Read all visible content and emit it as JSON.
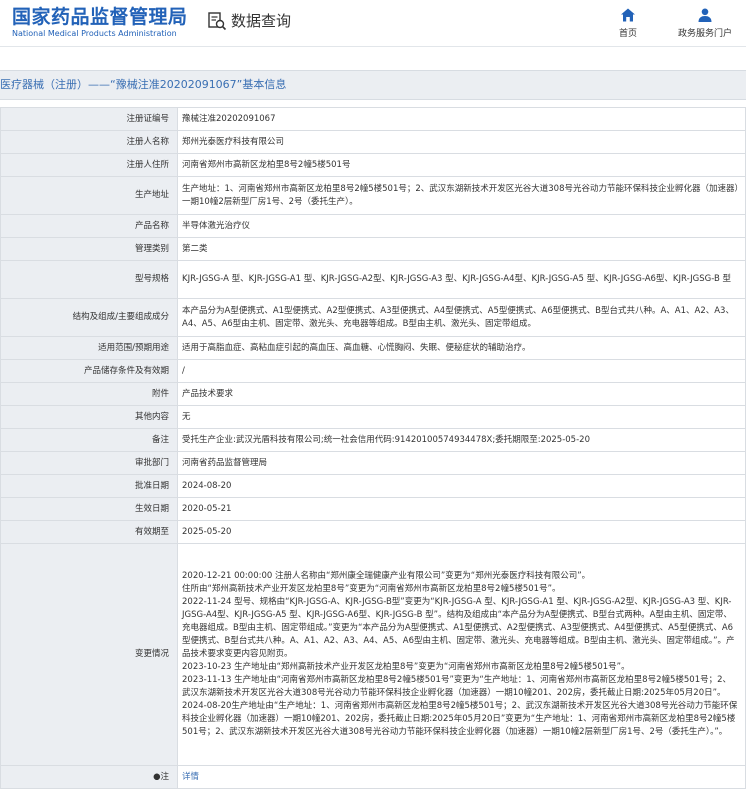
{
  "header": {
    "brand_cn": "国家药品监督管理局",
    "brand_en": "National Medical Products Administration",
    "query_label": "数据查询",
    "nav": [
      {
        "label": "首页",
        "icon": "home-icon"
      },
      {
        "label": "政务服务门户",
        "icon": "user-icon"
      }
    ]
  },
  "title": {
    "prefix": "医疗器械（注册）——",
    "highlight": "“豫械注准20202091067”",
    "suffix": "基本信息"
  },
  "rows": [
    {
      "label": "注册证编号",
      "value": "豫械注准20202091067"
    },
    {
      "label": "注册人名称",
      "value": "郑州光泰医疗科技有限公司"
    },
    {
      "label": "注册人住所",
      "value": "河南省郑州市高新区龙柏里8号2幢5楼501号"
    },
    {
      "label": "生产地址",
      "value": "生产地址：1、河南省郑州市高新区龙柏里8号2幢5楼501号；2、武汉东湖新技术开发区光谷大道308号光谷动力节能环保科技企业孵化器（加速器）一期10幢2层新型厂房1号、2号（委托生产）。"
    },
    {
      "label": "产品名称",
      "value": "半导体激光治疗仪"
    },
    {
      "label": "管理类别",
      "value": "第二类"
    },
    {
      "label": "型号规格",
      "value": "KJR-JGSG-A 型、KJR-JGSG-A1 型、KJR-JGSG-A2型、KJR-JGSG-A3 型、KJR-JGSG-A4型、KJR-JGSG-A5 型、KJR-JGSG-A6型、KJR-JGSG-B 型"
    },
    {
      "label": "结构及组成/主要组成成分",
      "value": "本产品分为A型便携式、A1型便携式、A2型便携式、A3型便携式、A4型便携式、A5型便携式、A6型便携式、B型台式共八种。A、A1、A2、A3、A4、A5、A6型由主机、固定带、激光头、充电器等组成。B型由主机、激光头、固定带组成。"
    },
    {
      "label": "适用范围/预期用途",
      "value": "适用于高脂血症、高粘血症引起的高血压、高血糖、心慌胸闷、失眠、便秘症状的辅助治疗。"
    },
    {
      "label": "产品储存条件及有效期",
      "value": "/"
    },
    {
      "label": "附件",
      "value": "产品技术要求"
    },
    {
      "label": "其他内容",
      "value": "无"
    },
    {
      "label": "备注",
      "value": "受托生产企业:武汉光盾科技有限公司;统一社会信用代码:91420100574934478X;委托期限至:2025-05-20"
    },
    {
      "label": "审批部门",
      "value": "河南省药品监督管理局"
    },
    {
      "label": "批准日期",
      "value": "2024-08-20"
    },
    {
      "label": "生效日期",
      "value": "2020-05-21"
    },
    {
      "label": "有效期至",
      "value": "2025-05-20"
    }
  ],
  "change": {
    "label": "变更情况",
    "lines": [
      "2020-12-21 00:00:00 注册人名称由“郑州康全瑞健康产业有限公司”变更为“郑州光泰医疗科技有限公司”。",
      "住所由“郑州高新技术产业开发区龙柏里8号”变更为“河南省郑州市高新区龙柏里8号2幢5楼501号”。",
      "2022-11-24 型号、规格由“KJR-JGSG-A、KJR-JGSG-B型”变更为“KJR-JGSG-A 型、KJR-JGSG-A1 型、KJR-JGSG-A2型、KJR-JGSG-A3 型、KJR-JGSG-A4型、KJR-JGSG-A5 型、KJR-JGSG-A6型、KJR-JGSG-B 型”。结构及组成由“本产品分为A型便携式、B型台式两种。A型由主机、固定带、充电器组成。B型由主机、固定带组成。”变更为“本产品分为A型便携式、A1型便携式、A2型便携式、A3型便携式、A4型便携式、A5型便携式、A6型便携式、B型台式共八种。A、A1、A2、A3、A4、A5、A6型由主机、固定带、激光头、充电器等组成。B型由主机、激光头、固定带组成。”。产品技术要求变更内容见附页。",
      "2023-10-23 生产地址由“郑州高新技术产业开发区龙柏里8号”变更为“河南省郑州市高新区龙柏里8号2幢5楼501号”。",
      "2023-11-13 生产地址由“河南省郑州市高新区龙柏里8号2幢5楼501号”变更为“生产地址：1、河南省郑州市高新区龙柏里8号2幢5楼501号；2、武汉东湖新技术开发区光谷大道308号光谷动力节能环保科技企业孵化器（加速器）一期10幢201、202房，委托截止日期:2025年05月20日”。2024-08-20生产地址由“生产地址：1、河南省郑州市高新区龙柏里8号2幢5楼501号；2、武汉东湖新技术开发区光谷大道308号光谷动力节能环保科技企业孵化器（加速器）一期10幢201、202房，委托截止日期:2025年05月20日”变更为“生产地址：1、河南省郑州市高新区龙柏里8号2幢5楼501号；2、武汉东湖新技术开发区光谷大道308号光谷动力节能环保科技企业孵化器（加速器）一期10幢2层新型厂房1号、2号（委托生产）。”。"
    ]
  },
  "last": {
    "label": "●注",
    "value": "详情"
  }
}
